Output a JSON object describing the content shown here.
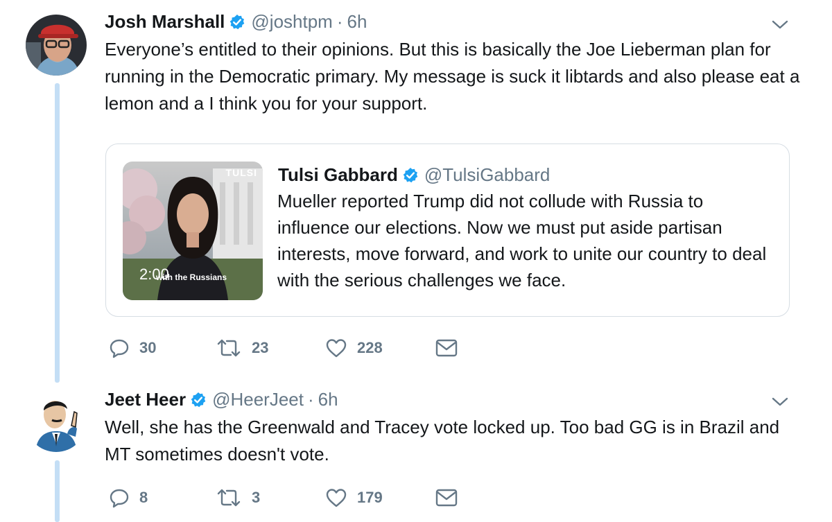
{
  "tweets": [
    {
      "name": "Josh Marshall",
      "handle": "@joshtpm",
      "separator": "·",
      "time": "6h",
      "text": "Everyone’s entitled to their opinions. But this is basically the Joe Lieberman plan for running in the Democratic primary. My message is suck it libtards and also please eat a lemon and a I think you for your support.",
      "quote": {
        "name": "Tulsi Gabbard",
        "handle": "@TulsiGabbard",
        "text": "Mueller reported Trump did not collude with Russia to influence our elections. Now we must put aside partisan interests, move forward, and work to unite our country to deal with the serious challenges we face.",
        "video_brand": "TULSI",
        "video_duration": "2:00",
        "video_caption": "with the Russians"
      },
      "actions": {
        "replies": "30",
        "retweets": "23",
        "likes": "228"
      }
    },
    {
      "name": "Jeet Heer",
      "handle": "@HeerJeet",
      "separator": "·",
      "time": "6h",
      "text": "Well, she has the Greenwald and Tracey vote locked up. Too bad GG is in Brazil and MT sometimes doesn't vote.",
      "actions": {
        "replies": "8",
        "retweets": "3",
        "likes": "179"
      }
    }
  ],
  "icons": {
    "verified": "verified-badge-icon",
    "caret": "chevron-down-icon",
    "reply": "reply-icon",
    "retweet": "retweet-icon",
    "like": "heart-icon",
    "dm": "envelope-icon"
  },
  "colors": {
    "verified": "#1da1f2",
    "thread_line": "#c4def5",
    "secondary_text": "#657786",
    "border": "#d6dde3"
  }
}
